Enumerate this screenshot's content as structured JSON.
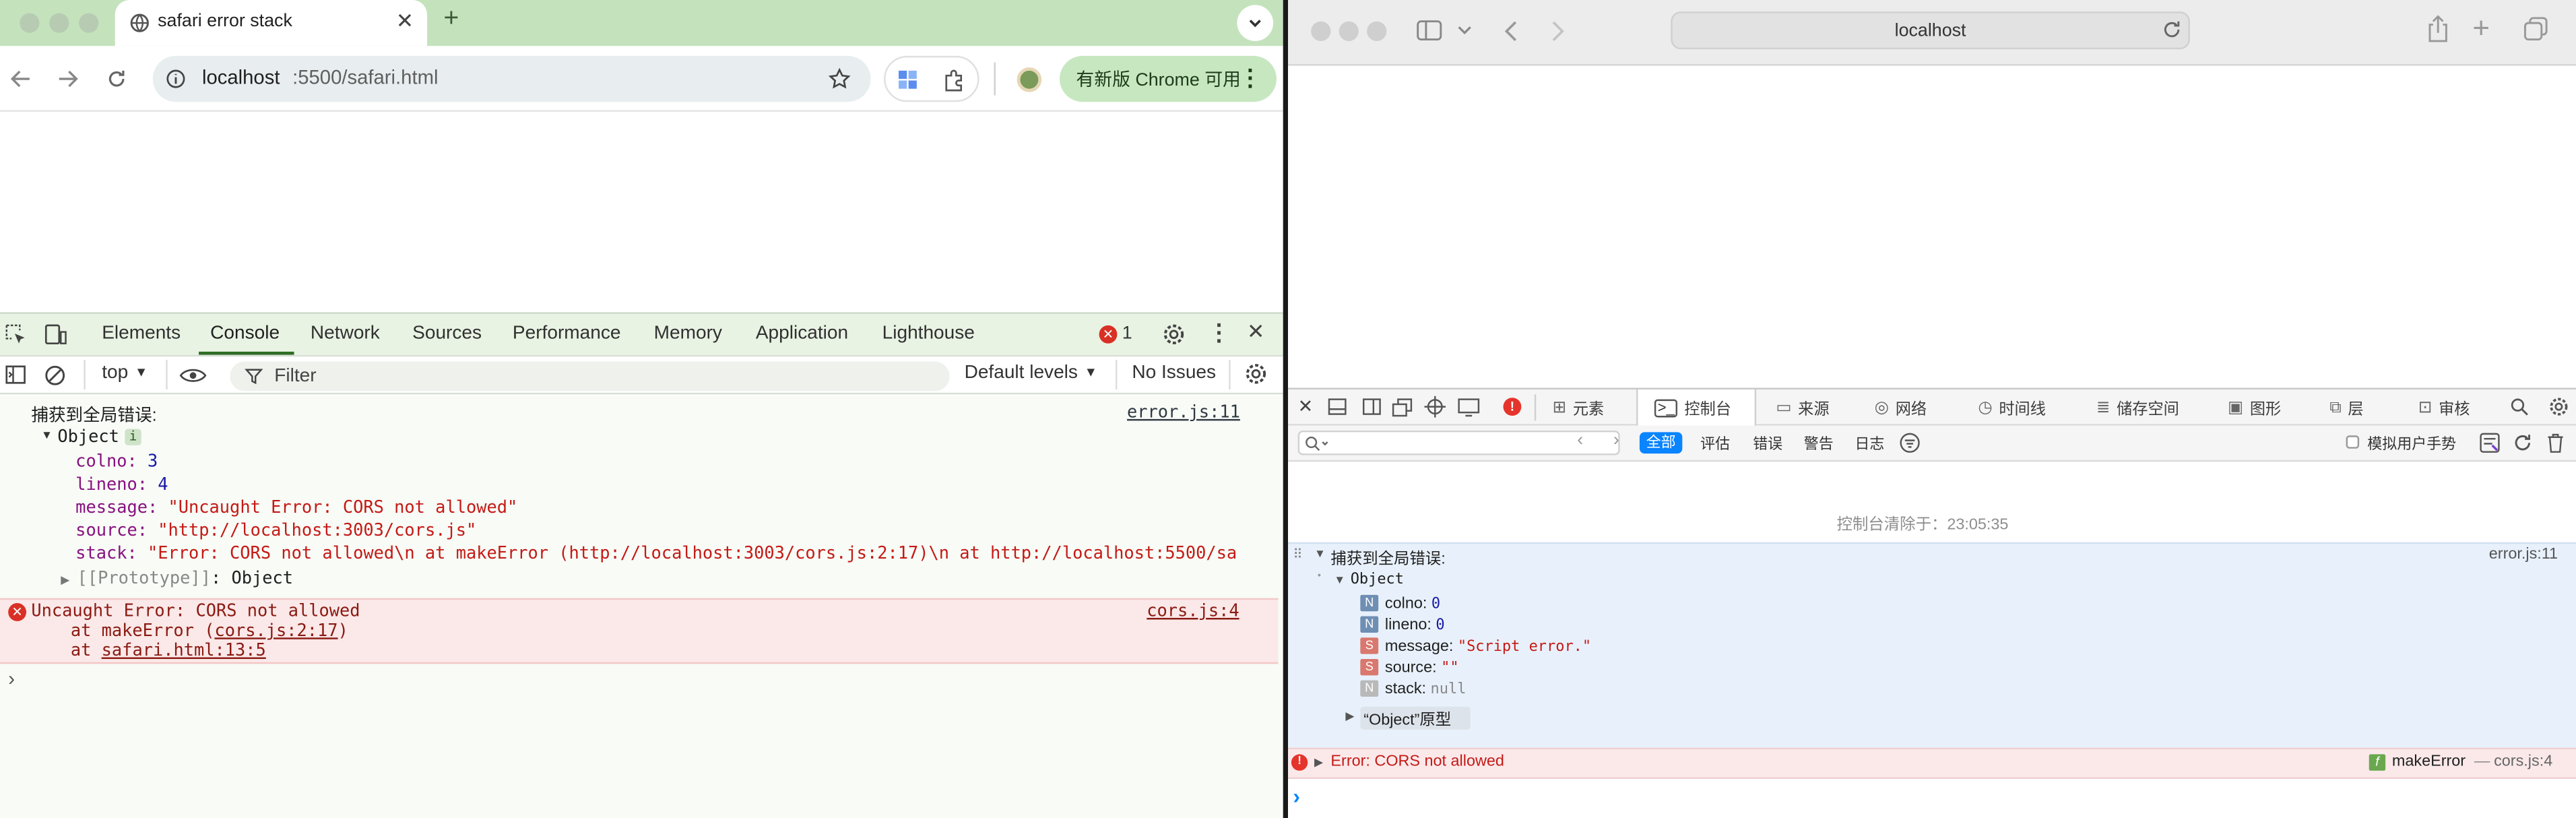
{
  "chrome": {
    "tab_title": "safari error stack",
    "url_host": "localhost",
    "url_path": ":5500/safari.html",
    "update_pill": "有新版 Chrome 可用",
    "devtools_tabs": [
      "Elements",
      "Console",
      "Network",
      "Sources",
      "Performance",
      "Memory",
      "Application",
      "Lighthouse"
    ],
    "error_count": "1",
    "context": "top",
    "filter_placeholder": "Filter",
    "levels": "Default levels",
    "issues": "No Issues",
    "console": {
      "log_title": "捕获到全局错误:",
      "log_source": "error.js:11",
      "object_label": "Object",
      "info_badge": "i",
      "props": [
        {
          "key": "colno",
          "value": "3",
          "kind": "num"
        },
        {
          "key": "lineno",
          "value": "4",
          "kind": "num"
        },
        {
          "key": "message",
          "value": "\"Uncaught Error: CORS not allowed\"",
          "kind": "str"
        },
        {
          "key": "source",
          "value": "\"http://localhost:3003/cors.js\"",
          "kind": "str"
        },
        {
          "key": "stack",
          "value": "\"Error: CORS not allowed\\n    at makeError (http://localhost:3003/cors.js:2:17)\\n    at http://localhost:5500/sa",
          "kind": "str"
        }
      ],
      "prototype": "[[Prototype]]",
      "prototype_value": "Object",
      "error_text": "Uncaught Error: CORS not allowed",
      "error_source": "cors.js:4",
      "frame1_prefix": "at makeError (",
      "frame1_link": "cors.js:2:17",
      "frame1_suffix": ")",
      "frame2_prefix": "at",
      "frame2_link": "safari.html:13:5",
      "prompt": "›"
    }
  },
  "safari": {
    "address": "localhost",
    "tabs": [
      "元素",
      "控制台",
      "来源",
      "网络",
      "时间线",
      "储存空间",
      "图形",
      "层",
      "审核"
    ],
    "filters": [
      "全部",
      "评估",
      "错误",
      "警告",
      "日志"
    ],
    "simulate": "模拟用户手势",
    "cleared": "控制台清除于：23:05:35",
    "log_title": "捕获到全局错误:",
    "log_source": "error.js:11",
    "object_label": "Object",
    "props": [
      {
        "badge": "N",
        "key": "colno:",
        "value": "0",
        "kind": "num"
      },
      {
        "badge": "N",
        "key": "lineno:",
        "value": "0",
        "kind": "num"
      },
      {
        "badge": "S",
        "key": "message:",
        "value": "\"Script error.\"",
        "kind": "str"
      },
      {
        "badge": "S",
        "key": "source:",
        "value": "\"\"",
        "kind": "str"
      },
      {
        "badge": "N",
        "key": "stack:",
        "value": "null",
        "kind": "null"
      }
    ],
    "prototype": "“Object”原型",
    "error_text": "Error: CORS not allowed",
    "fn_badge": "f",
    "error_fn": "makeError",
    "error_sep": "—",
    "error_source": "cors.js:4",
    "prompt": "›"
  },
  "colors": {
    "chrome_frame": "#c4e3bd",
    "devtools_tint": "#e8f3e3",
    "error_red": "#d93025",
    "safari_blue": "#0a84ff"
  }
}
